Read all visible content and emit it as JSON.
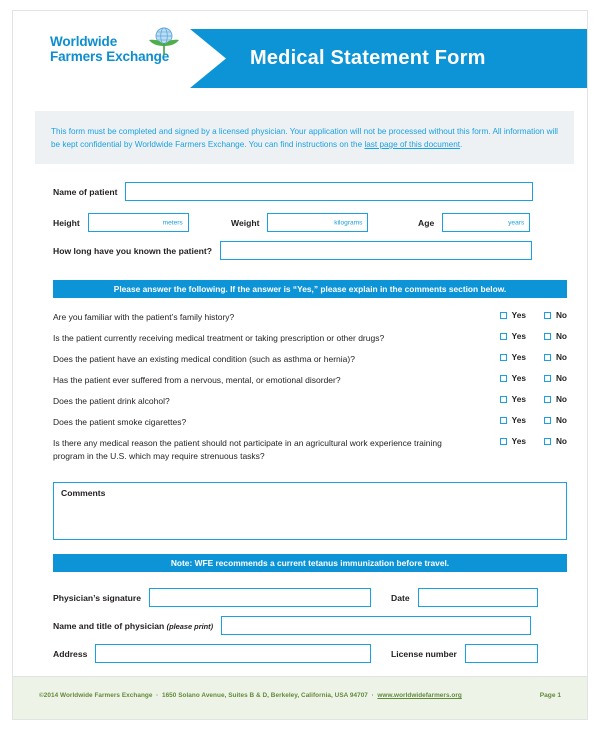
{
  "brand": {
    "logo_line1": "Worldwide",
    "logo_line2": "Farmers Exchange",
    "logo_icon": "globe-leaf-icon",
    "accent_blue": "#0d94d6",
    "link_blue": "#1ba1e2",
    "footer_green": "#5f8b3a"
  },
  "header": {
    "title": "Medical Statement Form"
  },
  "instructions": {
    "text_before_link": "This form must be completed and signed by a licensed physician. Your application will not be processed without this form. All information will be kept confidential by Worldwide Farmers Exchange. You can find instructions on the ",
    "link_text": "last page of this document",
    "text_after_link": "."
  },
  "patient": {
    "name_label": "Name of patient",
    "name_value": "",
    "height_label": "Height",
    "height_value": "",
    "height_unit": "meters",
    "weight_label": "Weight",
    "weight_value": "",
    "weight_unit": "kilograms",
    "age_label": "Age",
    "age_value": "",
    "age_unit": "years",
    "known_label": "How long have you known the patient?",
    "known_value": ""
  },
  "questions_bar": "Please answer the following. If the answer is “Yes,” please explain in the comments section below.",
  "questions": [
    {
      "text": "Are you familiar with the patient’s family history?",
      "yes_label": "Yes",
      "no_label": "No",
      "yes_checked": false,
      "no_checked": false
    },
    {
      "text": "Is the patient currently receiving medical treatment or taking prescription or other drugs?",
      "yes_label": "Yes",
      "no_label": "No",
      "yes_checked": false,
      "no_checked": false
    },
    {
      "text": "Does the patient have an existing medical condition (such as asthma or hernia)?",
      "yes_label": "Yes",
      "no_label": "No",
      "yes_checked": false,
      "no_checked": false
    },
    {
      "text": "Has the patient ever suffered from a nervous, mental, or emotional disorder?",
      "yes_label": "Yes",
      "no_label": "No",
      "yes_checked": false,
      "no_checked": false
    },
    {
      "text": "Does the patient drink alcohol?",
      "yes_label": "Yes",
      "no_label": "No",
      "yes_checked": false,
      "no_checked": false
    },
    {
      "text": "Does the patient smoke cigarettes?",
      "yes_label": "Yes",
      "no_label": "No",
      "yes_checked": false,
      "no_checked": false
    },
    {
      "text": "Is there any medical reason the patient should not participate in an agricultural work experience training program in the U.S. which may require strenuous tasks?",
      "yes_label": "Yes",
      "no_label": "No",
      "yes_checked": false,
      "no_checked": false
    }
  ],
  "comments": {
    "label": "Comments",
    "value": ""
  },
  "note_bar": "Note: WFE recommends a current tetanus immunization before travel.",
  "signature": {
    "signature_label": "Physician’s signature",
    "signature_value": "",
    "date_label": "Date",
    "date_value": "",
    "name_title_label": "Name and title of physician",
    "name_title_hint": "(please print)",
    "name_title_value": "",
    "address_label": "Address",
    "address_value": "",
    "license_label": "License number",
    "license_value": ""
  },
  "footer": {
    "copyright": "©2014 Worldwide Farmers Exchange",
    "separator1": "·",
    "address": "1650 Solano Avenue, Suites B & D, Berkeley, California, USA 94707",
    "separator2": "·",
    "website": "www.worldwidefarmers.org",
    "page": "Page 1"
  }
}
